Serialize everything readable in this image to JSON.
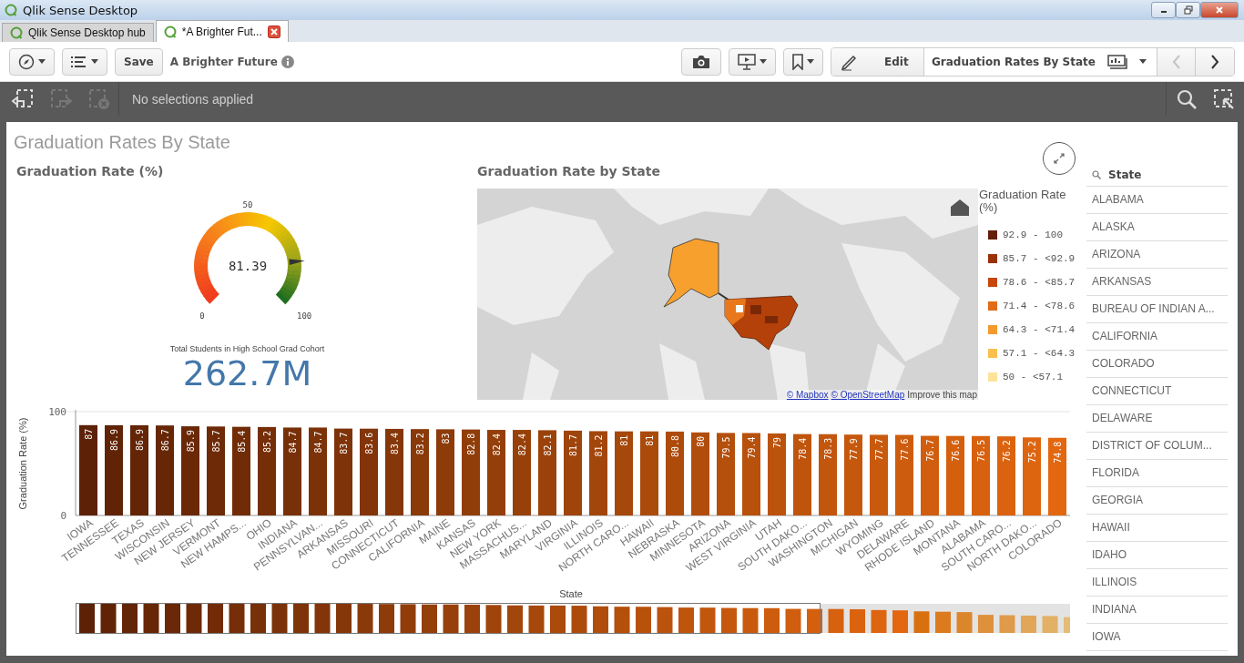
{
  "window": {
    "title": "Qlik Sense Desktop"
  },
  "tabs": [
    {
      "label": "Qlik Sense Desktop hub",
      "selected": false
    },
    {
      "label": "*A Brighter Fut...",
      "selected": true
    }
  ],
  "toolbar": {
    "save_label": "Save",
    "app_title": "A Brighter Future",
    "edit_label": "Edit",
    "sheet_title": "Graduation Rates By State",
    "previous_disabled": true,
    "next_disabled": false
  },
  "selections": {
    "status": "No selections applied",
    "back_disabled": false,
    "forward_disabled": true,
    "clear_disabled": true
  },
  "sheet": {
    "title": "Graduation Rates By State"
  },
  "gauge": {
    "title": "Graduation Rate (%)",
    "value": "81.39",
    "level": 0.8139,
    "ticks": [
      "0",
      "50",
      "100"
    ]
  },
  "kpi": {
    "label": "Total Students in High School Grad Cohort",
    "value": "262.7M"
  },
  "map": {
    "title": "Graduation Rate by State",
    "attribution_links": [
      "© Mapbox",
      "© OpenStreetMap"
    ],
    "attribution_text": "Improve this map",
    "legend": {
      "title": "Graduation Rate (%)",
      "items": [
        {
          "label": "92.9 - 100",
          "color": "#64200a"
        },
        {
          "label": "85.7 - <92.9",
          "color": "#9a3208"
        },
        {
          "label": "78.6 - <85.7",
          "color": "#c5470a"
        },
        {
          "label": "71.4 - <78.6",
          "color": "#e06c18"
        },
        {
          "label": "64.3 - <71.4",
          "color": "#f39a2c"
        },
        {
          "label": "57.1 - <64.3",
          "color": "#fbbf4e"
        },
        {
          "label": "50 - <57.1",
          "color": "#fde39a"
        }
      ]
    }
  },
  "bar_chart": {
    "chart_data": {
      "type": "bar",
      "xlabel": "State",
      "ylabel": "Graduation Rate (%)",
      "ylim": [
        0,
        100
      ],
      "yticks": [
        0,
        100
      ],
      "data_labels": true,
      "categories": [
        "IOWA",
        "TENNESSEE",
        "TEXAS",
        "WISCONSIN",
        "NEW JERSEY",
        "VERMONT",
        "NEW HAMPS...",
        "OHIO",
        "INDIANA",
        "PENNSYLVAN...",
        "ARKANSAS",
        "MISSOURI",
        "CONNECTICUT",
        "CALIFORNIA",
        "MAINE",
        "KANSAS",
        "NEW YORK",
        "MASSACHUS...",
        "MARYLAND",
        "VIRGINIA",
        "ILLINOIS",
        "NORTH CARO...",
        "HAWAII",
        "NEBRASKA",
        "MINNESOTA",
        "ARIZONA",
        "WEST VIRGINIA",
        "UTAH",
        "SOUTH DAKO...",
        "WASHINGTON",
        "MICHIGAN",
        "WYOMING",
        "DELAWARE",
        "RHODE ISLAND",
        "MONTANA",
        "ALABAMA",
        "SOUTH CARO...",
        "NORTH DAKO...",
        "COLORADO"
      ],
      "series": [
        {
          "values": [
            87,
            86.9,
            86.9,
            86.7,
            85.9,
            85.7,
            85.4,
            85.2,
            84.7,
            84.7,
            83.7,
            83.6,
            83.4,
            83.2,
            83,
            82.8,
            82.4,
            82.4,
            82.1,
            81.7,
            81.2,
            81,
            81,
            80.8,
            80,
            79.5,
            79.4,
            79,
            78.4,
            78.3,
            77.9,
            77.7,
            77.6,
            76.7,
            76.6,
            76.5,
            76.2,
            75.2,
            74.8
          ]
        }
      ]
    }
  },
  "filter": {
    "title": "State",
    "items": [
      "ALABAMA",
      "ALASKA",
      "ARIZONA",
      "ARKANSAS",
      "BUREAU OF INDIAN A...",
      "CALIFORNIA",
      "COLORADO",
      "CONNECTICUT",
      "DELAWARE",
      "DISTRICT OF COLUM...",
      "FLORIDA",
      "GEORGIA",
      "HAWAII",
      "IDAHO",
      "ILLINOIS",
      "INDIANA",
      "IOWA"
    ]
  }
}
